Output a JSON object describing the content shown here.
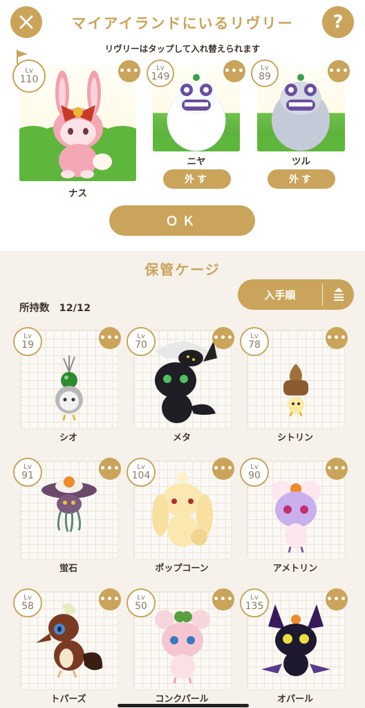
{
  "header": {
    "title": "マイアイランドにいるリヴリー",
    "subtitle": "リヴリーはタップして入れ替えられます",
    "close_icon": "close-icon",
    "help_label": "?"
  },
  "party": [
    {
      "name": "ナス",
      "lv_label": "Lv",
      "level": "110"
    },
    {
      "name": "ニヤ",
      "lv_label": "Lv",
      "level": "149",
      "remove_label": "外す"
    },
    {
      "name": "ツル",
      "lv_label": "Lv",
      "level": "89",
      "remove_label": "外す"
    }
  ],
  "ok_label": "ＯＫ",
  "storage": {
    "title": "保管ケージ",
    "sort_label": "入手順",
    "count_label": "所持数",
    "count_value": "12/12",
    "pets": [
      {
        "name": "シオ",
        "lv_label": "Lv",
        "level": "19"
      },
      {
        "name": "メタ",
        "lv_label": "Lv",
        "level": "70"
      },
      {
        "name": "シトリン",
        "lv_label": "Lv",
        "level": "78"
      },
      {
        "name": "蛍石",
        "lv_label": "Lv",
        "level": "91"
      },
      {
        "name": "ポップコーン",
        "lv_label": "Lv",
        "level": "104"
      },
      {
        "name": "アメトリン",
        "lv_label": "Lv",
        "level": "90"
      },
      {
        "name": "トパーズ",
        "lv_label": "Lv",
        "level": "58"
      },
      {
        "name": "コンクパール",
        "lv_label": "Lv",
        "level": "50"
      },
      {
        "name": "オパール",
        "lv_label": "Lv",
        "level": "135"
      }
    ]
  },
  "colors": {
    "accent": "#c9a45a",
    "storage_bg": "#f6f1ea"
  }
}
